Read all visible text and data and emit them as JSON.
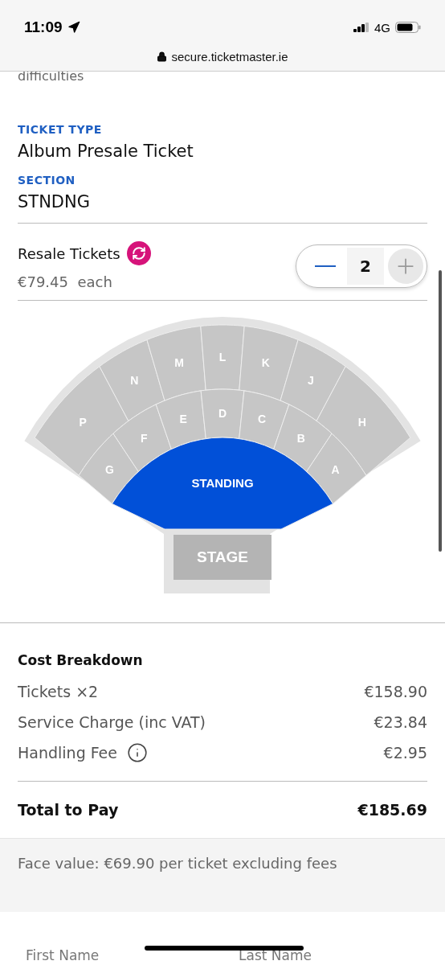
{
  "status_bar": {
    "time": "11:09",
    "network": "4G"
  },
  "browser": {
    "url": "secure.ticketmaster.ie"
  },
  "previous_text": "difficulties",
  "ticket_type": {
    "label": "TICKET TYPE",
    "value": "Album Presale Ticket"
  },
  "section": {
    "label": "SECTION",
    "value": "STNDNG"
  },
  "resale": {
    "title": "Resale Tickets",
    "price": "€79.45  each",
    "quantity": "2"
  },
  "seat_map": {
    "upper": [
      {
        "label": "P",
        "selected": false
      },
      {
        "label": "N",
        "selected": false
      },
      {
        "label": "M",
        "selected": false
      },
      {
        "label": "L",
        "selected": false
      },
      {
        "label": "K",
        "selected": false
      },
      {
        "label": "J",
        "selected": false
      },
      {
        "label": "H",
        "selected": false
      }
    ],
    "lower": [
      {
        "label": "G",
        "selected": false
      },
      {
        "label": "F",
        "selected": false
      },
      {
        "label": "E",
        "selected": false
      },
      {
        "label": "D",
        "selected": false
      },
      {
        "label": "C",
        "selected": false
      },
      {
        "label": "B",
        "selected": false
      },
      {
        "label": "A",
        "selected": false
      }
    ],
    "floor": {
      "label": "STANDING",
      "selected": true
    },
    "stage": "STAGE"
  },
  "cost_breakdown": {
    "title": "Cost Breakdown",
    "rows": [
      {
        "label": "Tickets ×2",
        "amount": "€158.90",
        "info": false
      },
      {
        "label": "Service Charge (inc VAT)",
        "amount": "€23.84",
        "info": false
      },
      {
        "label": "Handling Fee",
        "amount": "€2.95",
        "info": true
      }
    ]
  },
  "total": {
    "label": "Total to Pay",
    "amount": "€185.69"
  },
  "face_value": "Face value: €69.90 per ticket excluding fees",
  "form": {
    "fields": [
      {
        "label": "First Name"
      },
      {
        "label": "Last Name"
      }
    ]
  }
}
